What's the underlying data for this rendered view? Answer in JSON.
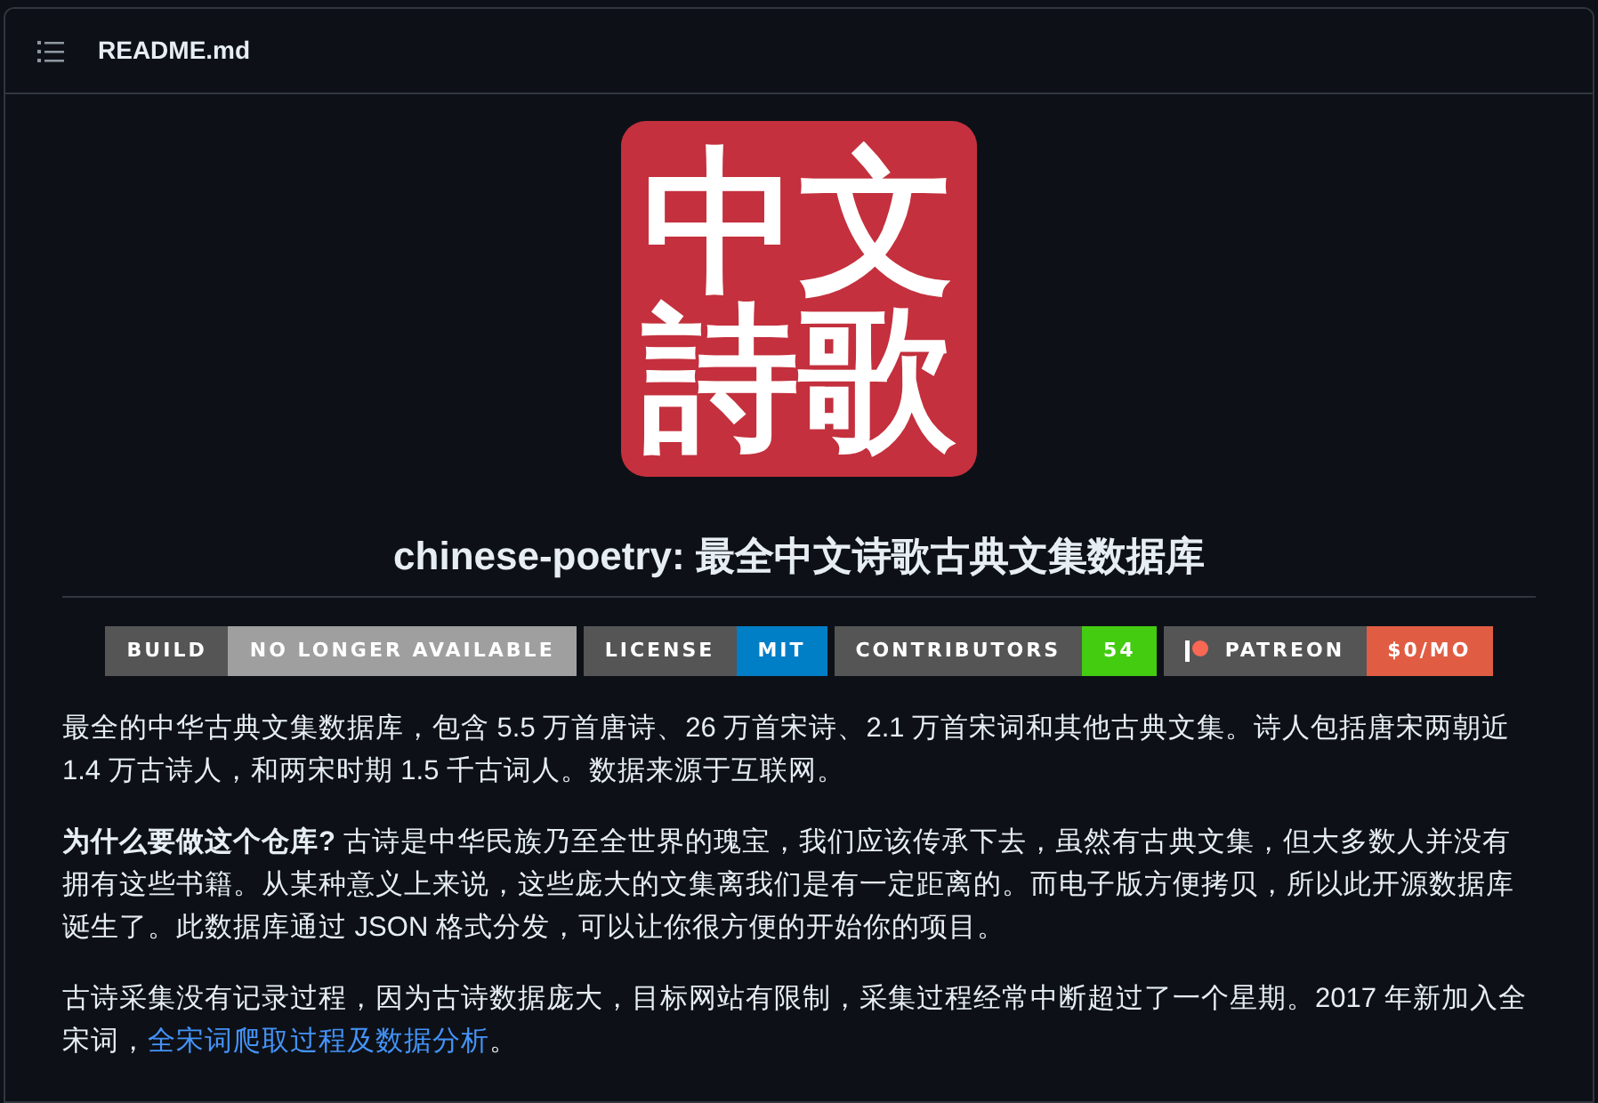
{
  "header": {
    "title": "README.md"
  },
  "logo": {
    "characters": [
      "中",
      "文",
      "詩",
      "歌"
    ]
  },
  "heading": {
    "prefix": "chinese-poetry:",
    "main": "最全中文诗歌古典文集数据库"
  },
  "badges": [
    {
      "label": "BUILD",
      "value": "NO LONGER AVAILABLE",
      "color": "#9f9f9f",
      "kind": "plain"
    },
    {
      "label": "LICENSE",
      "value": "MIT",
      "color": "#007ec6",
      "kind": "plain"
    },
    {
      "label": "CONTRIBUTORS",
      "value": "54",
      "color": "#4c1",
      "kind": "plain"
    },
    {
      "label": "PATREON",
      "value": "$0/MO",
      "color": "#e05d44",
      "kind": "patreon"
    }
  ],
  "paragraphs": [
    {
      "parts": [
        {
          "kind": "text",
          "text": "最全的中华古典文集数据库，包含 5.5 万首唐诗、26 万首宋诗、2.1 万首宋词和其他古典文集。诗人包括唐宋两朝近 1.4 万古诗人，和两宋时期 1.5 千古词人。数据来源于互联网。"
        }
      ]
    },
    {
      "parts": [
        {
          "kind": "text",
          "text": "**为什么要做这个仓库?** 古诗是中华民族乃至全世界的瑰宝，我们应该传承下去，虽然有古典文集，但大多数人并没有拥有这些书籍。从某种意义上来说，这些庞大的文集离我们是有一定距离的。而电子版方便拷贝，所以此开源数据库诞生了。此数据库通过 JSON 格式分发，可以让你很方便的开始你的项目。"
        }
      ]
    },
    {
      "parts": [
        {
          "kind": "text",
          "text": "古诗采集没有记录过程，因为古诗数据庞大，目标网站有限制，采集过程经常中断超过了一个星期。2017 年新加入全宋词，"
        },
        {
          "kind": "link",
          "text": "全宋词爬取过程及数据分析"
        },
        {
          "kind": "text",
          "text": "。"
        }
      ]
    }
  ]
}
